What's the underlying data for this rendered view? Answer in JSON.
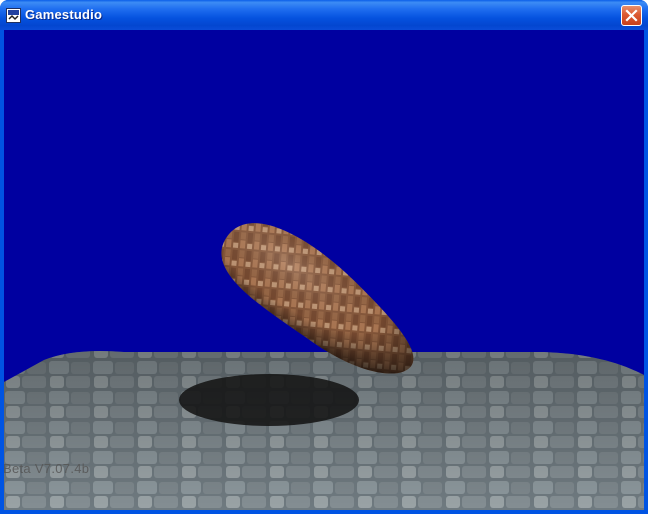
{
  "window": {
    "title": "Gamestudio",
    "app_icon": "gamestudio-app-icon",
    "close_icon": "close-icon"
  },
  "viewport": {
    "background_color": "#0000a0",
    "objects": [
      "textured-egg-model",
      "stone-floor",
      "shadow"
    ],
    "version_label": "Beta V7.07.4b"
  },
  "colors": {
    "titlebar": "#0054e3",
    "close_button": "#dc5a32",
    "sky": "#0000a0"
  }
}
